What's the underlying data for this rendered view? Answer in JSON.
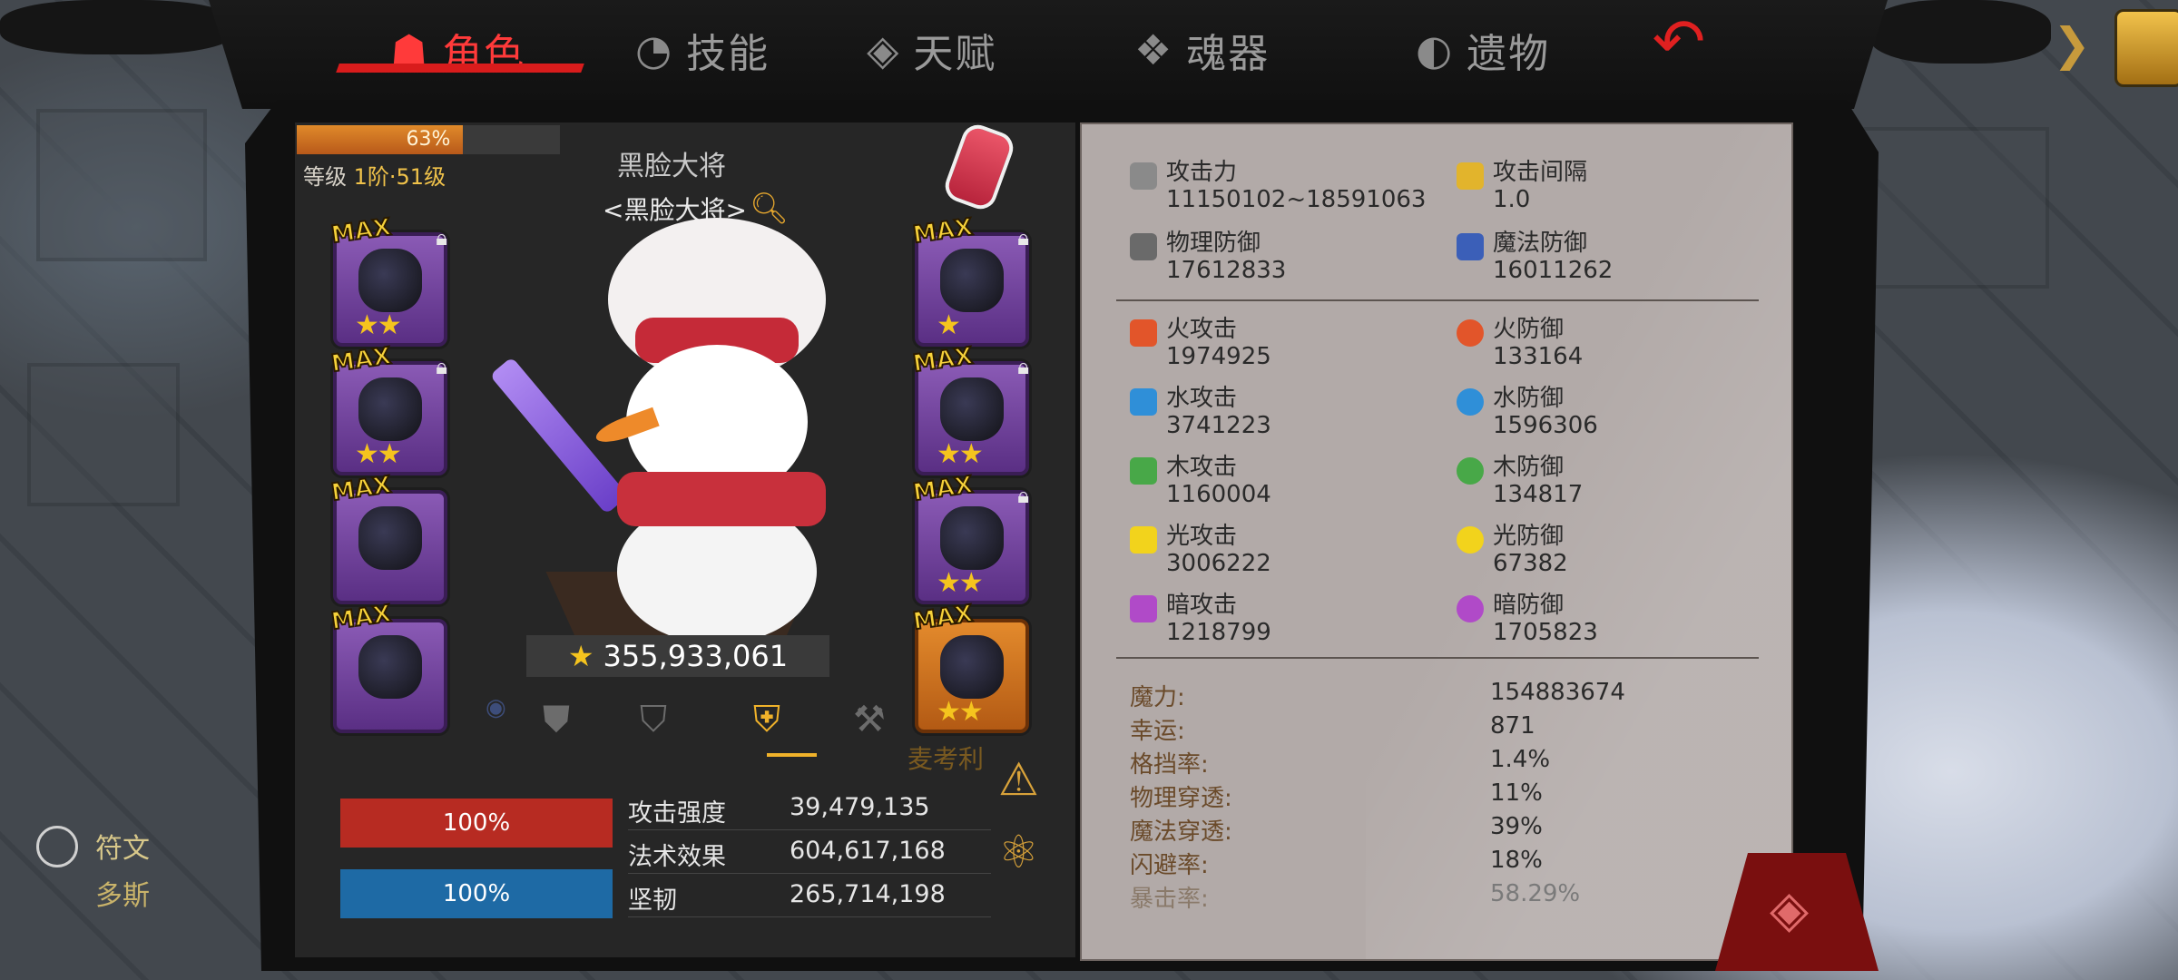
{
  "tabs": [
    {
      "icon": "demon-icon",
      "label": "角色",
      "active": true
    },
    {
      "icon": "skill-icon",
      "label": "技能",
      "active": false
    },
    {
      "icon": "talent-icon",
      "label": "天赋",
      "active": false
    },
    {
      "icon": "soul-icon",
      "label": "魂器",
      "active": false
    },
    {
      "icon": "relic-icon",
      "label": "遗物",
      "active": false
    }
  ],
  "hero": {
    "exp_percent": 63,
    "exp_text": "63%",
    "level_prefix": "等级",
    "level_value": "1阶·51级",
    "name": "黑脸大将",
    "title": "<黑脸大将>",
    "power": "355,933,061"
  },
  "slots": [
    "MAX",
    "MAX",
    "MAX",
    "MAX",
    "MAX",
    "MAX",
    "MAX",
    "MAX"
  ],
  "misc_labels": {
    "mackley": "麦考利",
    "rune": "符文",
    "doss": "多斯"
  },
  "bars": {
    "hp": "100%",
    "mp": "100%"
  },
  "bottom_stats": [
    {
      "label": "攻击强度",
      "value": "39,479,135"
    },
    {
      "label": "法术效果",
      "value": "604,617,168"
    },
    {
      "label": "坚韧",
      "value": "265,714,198"
    }
  ],
  "attrs": {
    "atk": {
      "label": "攻击力",
      "value": "11150102~18591063"
    },
    "atk_interval": {
      "label": "攻击间隔",
      "value": "1.0"
    },
    "phys_def": {
      "label": "物理防御",
      "value": "17612833"
    },
    "mag_def": {
      "label": "魔法防御",
      "value": "16011262"
    },
    "fire_atk": {
      "label": "火攻击",
      "value": "1974925"
    },
    "fire_def": {
      "label": "火防御",
      "value": "133164"
    },
    "water_atk": {
      "label": "水攻击",
      "value": "3741223"
    },
    "water_def": {
      "label": "水防御",
      "value": "1596306"
    },
    "wood_atk": {
      "label": "木攻击",
      "value": "1160004"
    },
    "wood_def": {
      "label": "木防御",
      "value": "134817"
    },
    "light_atk": {
      "label": "光攻击",
      "value": "3006222"
    },
    "light_def": {
      "label": "光防御",
      "value": "67382"
    },
    "dark_atk": {
      "label": "暗攻击",
      "value": "1218799"
    },
    "dark_def": {
      "label": "暗防御",
      "value": "1705823"
    }
  },
  "misc_stats": [
    {
      "label": "魔力:",
      "value": "154883674"
    },
    {
      "label": "幸运:",
      "value": "871"
    },
    {
      "label": "格挡率:",
      "value": "1.4%"
    },
    {
      "label": "物理穿透:",
      "value": "11%"
    },
    {
      "label": "魔法穿透:",
      "value": "39%"
    },
    {
      "label": "闪避率:",
      "value": "18%"
    },
    {
      "label": "暴击率:",
      "value": "58.29%"
    }
  ],
  "colors": {
    "accent_red": "#d91c1c",
    "gold": "#f5c41e",
    "hp": "#b72b22",
    "mp": "#1e6aa5",
    "fire": "#e2552a",
    "water": "#2f8fd8",
    "wood": "#48a848",
    "light": "#f2d31c",
    "dark": "#b04ac8"
  }
}
